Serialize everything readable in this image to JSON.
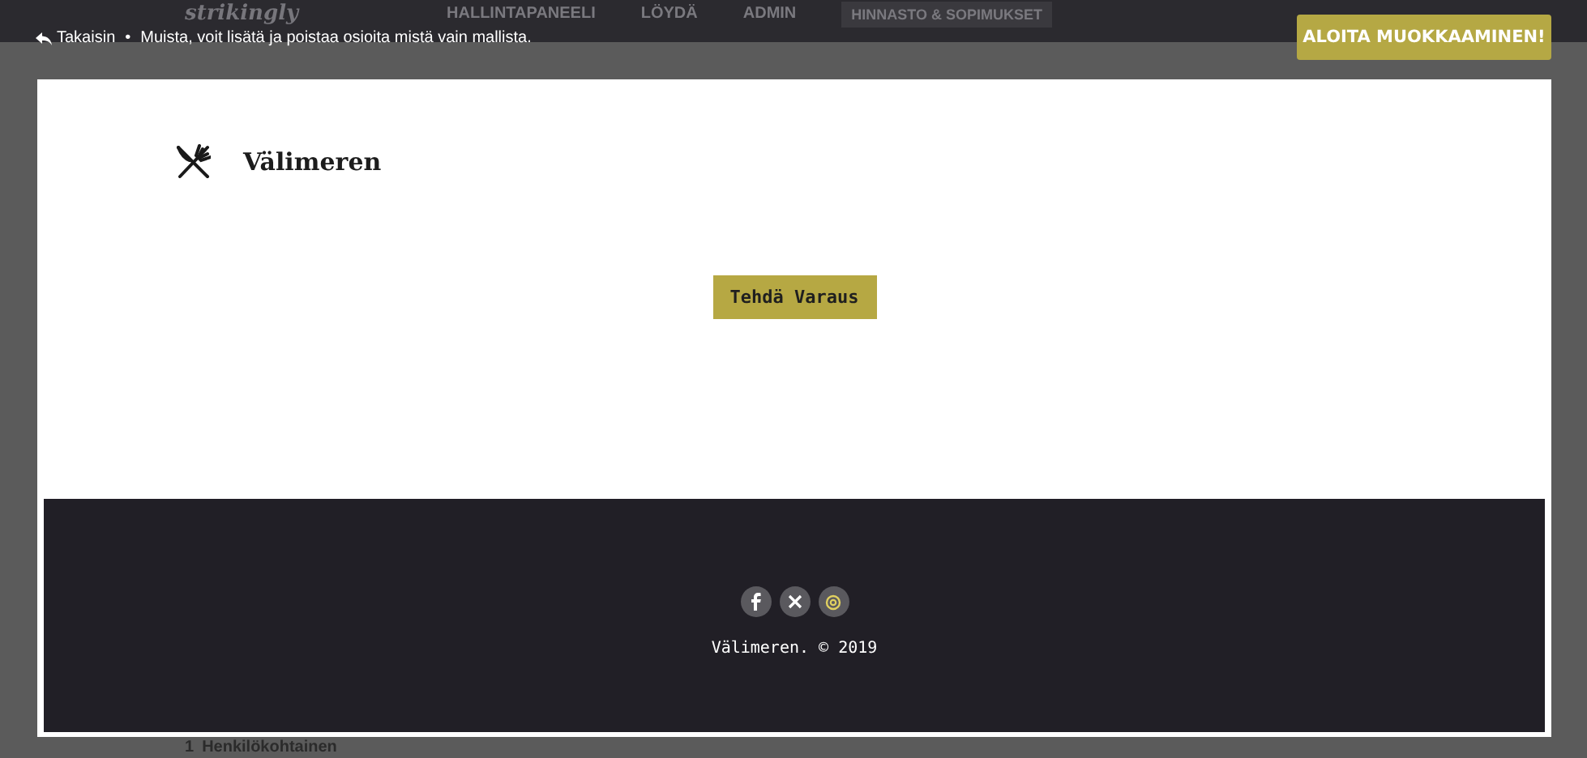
{
  "background_nav": {
    "logo": "strikingly",
    "items": [
      "HALLINTAPANEELI",
      "LÖYDÄ",
      "ADMIN"
    ],
    "pricing": "HINNASTO & SOPIMUKSET"
  },
  "editor_bar": {
    "back": "Takaisin",
    "separator": "•",
    "hint": "Muista, voit lisätä ja poistaa osioita mistä vain mallista.",
    "start_button": "ALOITA MUOKKAAMINEN!"
  },
  "site": {
    "brand": "Välimeren",
    "reserve_button": "Tehdä Varaus",
    "footer": {
      "social": [
        {
          "kind": "facebook"
        },
        {
          "kind": "x"
        },
        {
          "kind": "instagram"
        }
      ],
      "copyright": "Välimeren. © 2019"
    }
  },
  "background_list": {
    "number": "1",
    "label": "Henkilökohtainen"
  }
}
